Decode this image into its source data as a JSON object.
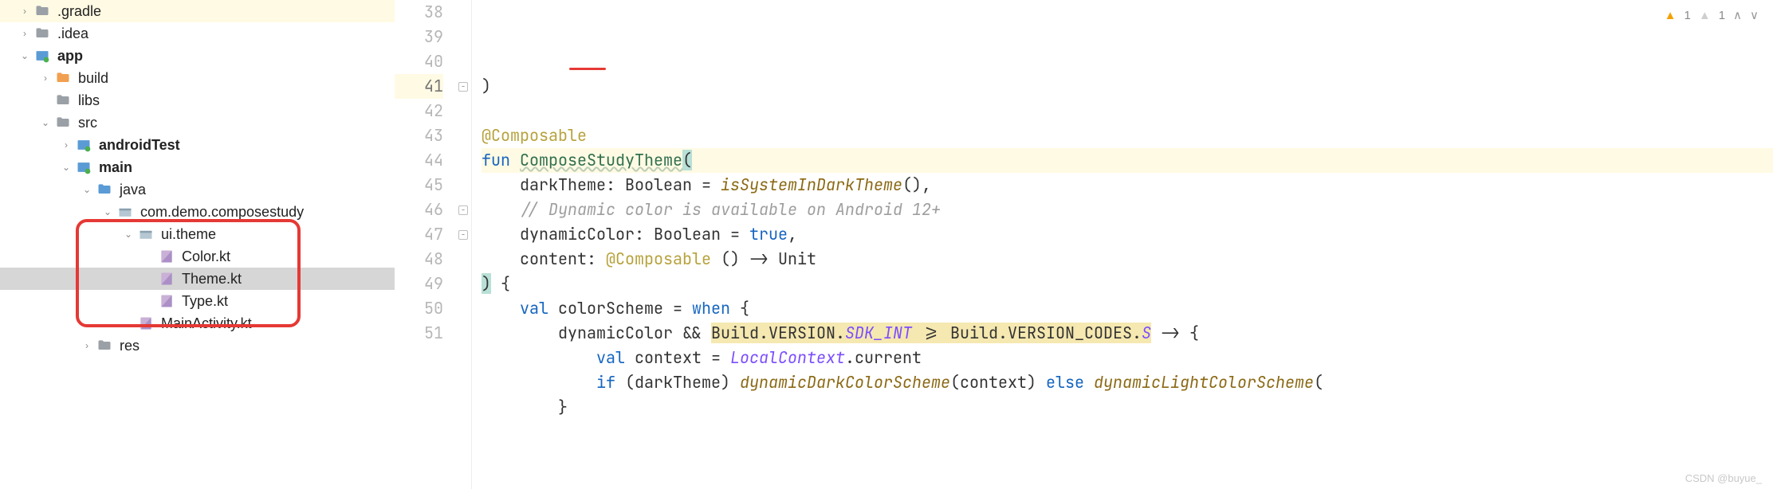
{
  "tree": {
    "rows": [
      {
        "indent": 0,
        "chevron": "right",
        "icon": "folder-gray",
        "label": ".gradle",
        "bold": false,
        "hl": "yellow"
      },
      {
        "indent": 0,
        "chevron": "right",
        "icon": "folder-gray",
        "label": ".idea",
        "bold": false
      },
      {
        "indent": 0,
        "chevron": "down",
        "icon": "module",
        "label": "app",
        "bold": true
      },
      {
        "indent": 1,
        "chevron": "right",
        "icon": "folder-orange",
        "label": "build",
        "bold": false
      },
      {
        "indent": 1,
        "chevron": "blank",
        "icon": "folder-gray",
        "label": "libs",
        "bold": false
      },
      {
        "indent": 1,
        "chevron": "down",
        "icon": "folder-gray",
        "label": "src",
        "bold": false
      },
      {
        "indent": 2,
        "chevron": "right",
        "icon": "module",
        "label": "androidTest",
        "bold": true
      },
      {
        "indent": 2,
        "chevron": "down",
        "icon": "module",
        "label": "main",
        "bold": true
      },
      {
        "indent": 3,
        "chevron": "down",
        "icon": "folder-blue",
        "label": "java",
        "bold": false
      },
      {
        "indent": 4,
        "chevron": "down",
        "icon": "package",
        "label": "com.demo.composestudy",
        "bold": false
      },
      {
        "indent": 5,
        "chevron": "down",
        "icon": "package",
        "label": "ui.theme",
        "bold": false
      },
      {
        "indent": 6,
        "chevron": "blank",
        "icon": "kt-file",
        "label": "Color.kt",
        "bold": false
      },
      {
        "indent": 6,
        "chevron": "blank",
        "icon": "kt-file",
        "label": "Theme.kt",
        "bold": false,
        "selected": true
      },
      {
        "indent": 6,
        "chevron": "blank",
        "icon": "kt-file",
        "label": "Type.kt",
        "bold": false
      },
      {
        "indent": 5,
        "chevron": "blank",
        "icon": "kt-file",
        "label": "MainActivity.kt",
        "bold": false
      },
      {
        "indent": 3,
        "chevron": "right",
        "icon": "folder-gray",
        "label": "res",
        "bold": false
      }
    ]
  },
  "editor": {
    "warnings": {
      "strong_label": "1",
      "weak_label": "1"
    },
    "lines": [
      {
        "n": 38,
        "code": ")"
      },
      {
        "n": 39,
        "code": ""
      },
      {
        "n": 40,
        "code": "@Composable"
      },
      {
        "n": 41,
        "code": "fun ComposeStudyTheme(",
        "current": true,
        "fold": true
      },
      {
        "n": 42,
        "code": "    darkTheme: Boolean = isSystemInDarkTheme(),"
      },
      {
        "n": 43,
        "code": "    // Dynamic color is available on Android 12+"
      },
      {
        "n": 44,
        "code": "    dynamicColor: Boolean = true,"
      },
      {
        "n": 45,
        "code": "    content: @Composable () -> Unit"
      },
      {
        "n": 46,
        "code": ") {",
        "fold": true
      },
      {
        "n": 47,
        "code": "    val colorScheme = when {",
        "fold": true
      },
      {
        "n": 48,
        "code": "        dynamicColor && Build.VERSION.SDK_INT >= Build.VERSION_CODES.S -> {"
      },
      {
        "n": 49,
        "code": "            val context = LocalContext.current"
      },
      {
        "n": 50,
        "code": "            if (darkTheme) dynamicDarkColorScheme(context) else dynamicLightColorScheme("
      },
      {
        "n": 51,
        "code": "        }"
      }
    ]
  },
  "watermark": "CSDN @buyue_"
}
